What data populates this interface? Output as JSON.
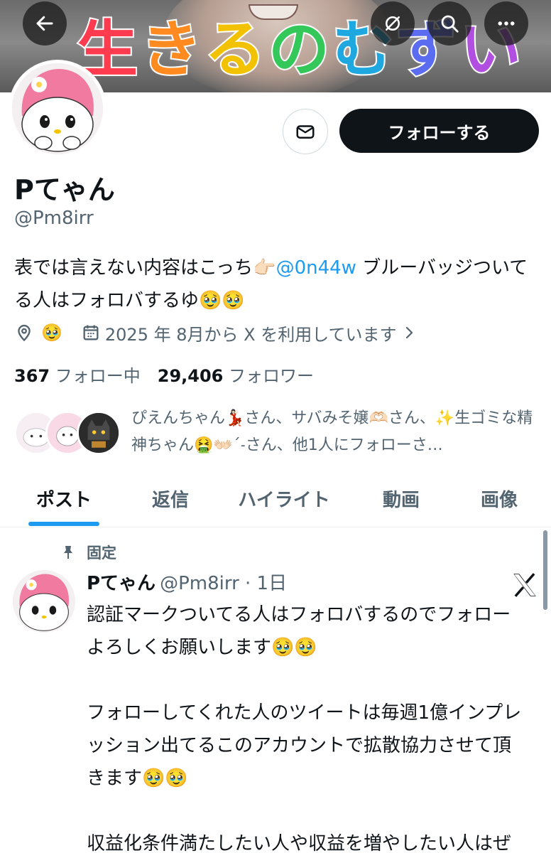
{
  "banner": {
    "text_chars": [
      "生",
      "き",
      "る",
      "の",
      "む",
      "ず",
      "い"
    ],
    "text_colors": [
      "#ff3b4f",
      "#ff8a1f",
      "#f2c200",
      "#34c759",
      "#1fa8e0",
      "#5b6cf0",
      "#b04fe0"
    ]
  },
  "topbar": {
    "back_icon": "arrow-left-icon",
    "filter_icon": "eye-slash-icon",
    "search_icon": "search-icon",
    "more_icon": "more-icon"
  },
  "profile": {
    "name": "Pてゃん",
    "handle": "@Pm8irr",
    "follow_label": "フォローする",
    "bio_before": "表では言えない内容はこっち👉🏻",
    "bio_mention": "@0n44w",
    "bio_after": " ブルーバッジついてる人はフォロバするゆ🥹🥹",
    "location": "🥹",
    "joined": "2025 年 8月から X を利用しています",
    "following_count": "367",
    "following_label": "フォロー中",
    "followers_count": "29,406",
    "followers_label": "フォロワー",
    "followers_you_know": "ぴえんちゃん💃🏻さん、サバみそ嬢🫶🏻さん、✨生ゴミな精神ちゃん🤮👐🏻ˊ˗さん、他1人にフォローさ…"
  },
  "tabs": [
    {
      "label": "ポスト"
    },
    {
      "label": "返信"
    },
    {
      "label": "ハイライト"
    },
    {
      "label": "動画"
    },
    {
      "label": "画像"
    }
  ],
  "post": {
    "pinned_label": "固定",
    "author_name": "Pてゃん",
    "author_handle_time": "@Pm8irr · 1日",
    "text": "認証マークついてる人はフォロバするのでフォローよろしくお願いします🥹🥹\n\nフォローしてくれた人のツイートは毎週1億インプレッション出てるこのアカウントで拡散協力させて頂きます🥹🥹\n\n収益化条件満たしたい人や収益を増やしたい人はぜひフォローしてください🥹🥹"
  },
  "colors": {
    "accent": "#1d9bf0",
    "text": "#0f1419",
    "muted": "#536471"
  }
}
